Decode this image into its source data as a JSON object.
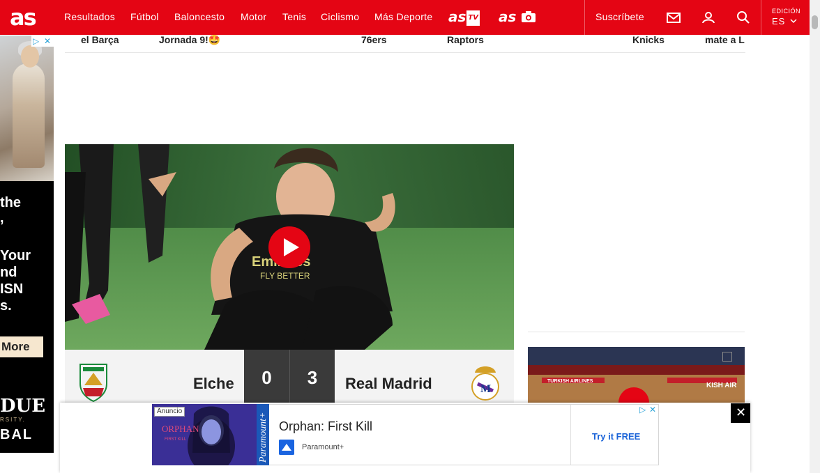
{
  "brand": {
    "logo_text": "as",
    "accent": "#e40514"
  },
  "nav": {
    "items": [
      "Resultados",
      "Fútbol",
      "Baloncesto",
      "Motor",
      "Tenis",
      "Ciclismo",
      "Más Deporte"
    ],
    "astv": "as",
    "astv_sub": "TV",
    "asfoto": "as",
    "subscribe": "Suscríbete",
    "icons": [
      "mail-icon",
      "user-icon",
      "search-icon"
    ],
    "edition_label": "EDICIÓN",
    "edition_value": "ES"
  },
  "headlines": [
    {
      "text": "el Barça"
    },
    {
      "text": "Jornada 9!🤩"
    },
    {
      "text": "76ers"
    },
    {
      "text": "Raptors"
    },
    {
      "text": "Knicks"
    },
    {
      "text": "mate a L"
    }
  ],
  "left_ad": {
    "lines": [
      "the",
      ",",
      "Your",
      "nd",
      "ISN",
      "s."
    ],
    "cta": "More",
    "brand": "DUE",
    "brand_sub": "RSITY.",
    "brand_line": "BAL"
  },
  "match": {
    "home_team": "Elche",
    "away_team": "Real Madrid",
    "home_score": "0",
    "away_score": "3"
  },
  "bottom_ad": {
    "label": "Anuncio",
    "title": "Orphan: First Kill",
    "advertiser": "Paramount+",
    "cta": "Try it FREE",
    "image_text": "ORPHAN",
    "image_sub": "FIRST KILL",
    "image_brand": "Paramount+"
  },
  "close_label": "✕"
}
